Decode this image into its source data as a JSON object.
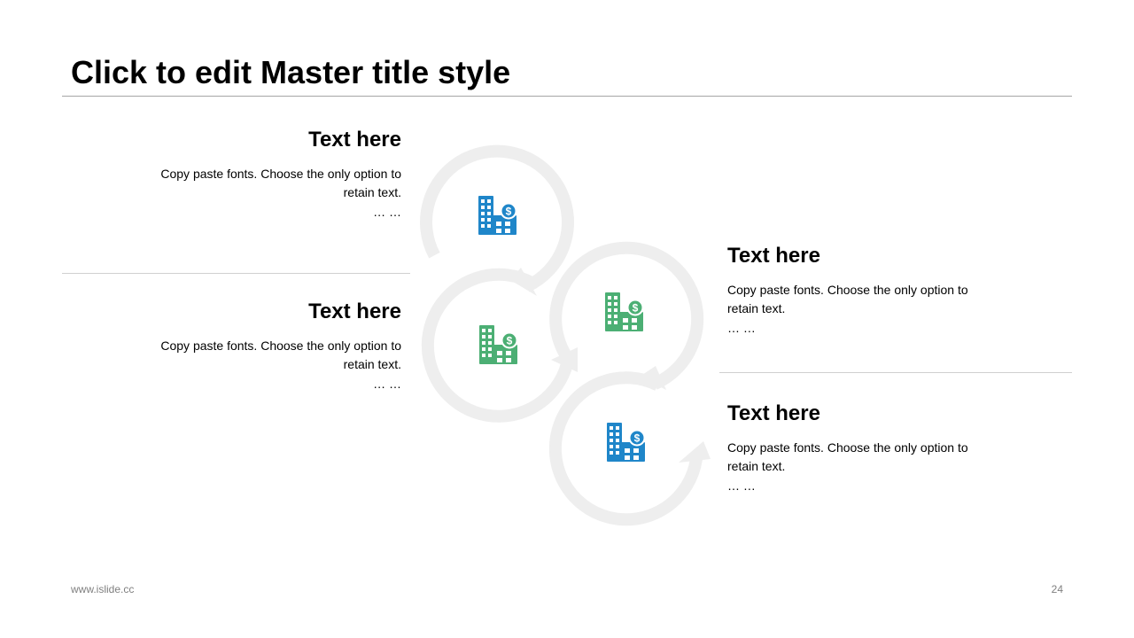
{
  "slide": {
    "title": "Click to edit Master title style",
    "footer_url": "www.islide.cc",
    "page_number": "24"
  },
  "blocks": [
    {
      "heading": "Text here",
      "body": "Copy paste fonts. Choose the only option to retain text.",
      "dots": "… …"
    },
    {
      "heading": "Text here",
      "body": "Copy paste fonts. Choose the only option to retain text.",
      "dots": "… …"
    },
    {
      "heading": "Text here",
      "body": "Copy paste fonts. Choose the only option to retain text.",
      "dots": "… …"
    },
    {
      "heading": "Text here",
      "body": "Copy paste fonts. Choose the only option to retain text.",
      "dots": "… …"
    }
  ],
  "colors": {
    "blue": "#1f86c9",
    "green": "#4caf74",
    "ring": "#eeeeee",
    "rule": "#a6a6a6"
  },
  "icons": [
    "building-dollar-icon",
    "building-dollar-icon",
    "building-dollar-icon",
    "building-dollar-icon"
  ]
}
